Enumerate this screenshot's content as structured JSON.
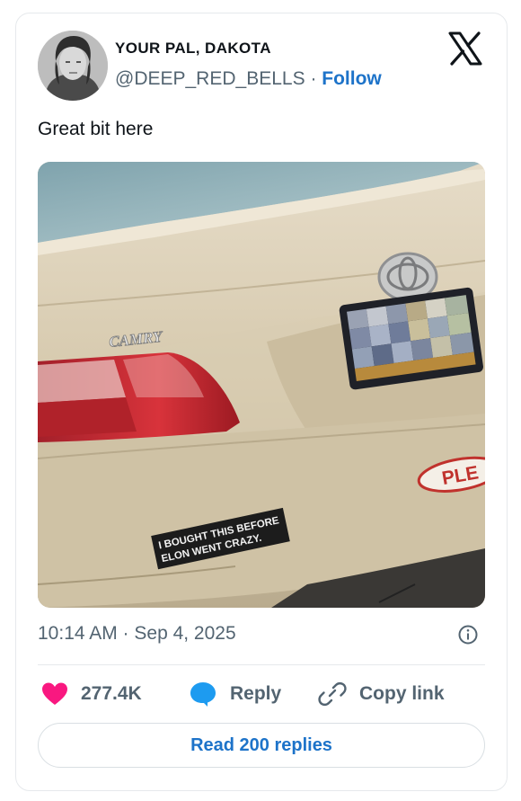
{
  "author": {
    "display_name": "YOUR PAL, DAKOTA",
    "handle": "@DEEP_RED_BELLS",
    "separator": "·",
    "follow_label": "Follow"
  },
  "brand_icon": "x-logo-icon",
  "tweet": {
    "text": "Great bit here",
    "timestamp": "10:14 AM · Sep 4, 2025"
  },
  "media": {
    "car_badge": "CAMRY",
    "sticker_line1": "I BOUGHT THIS BEFORE",
    "sticker_line2": "ELON WENT CRAZY.",
    "dealer_sticker": "PLE"
  },
  "actions": {
    "likes": "277.4K",
    "reply_label": "Reply",
    "copy_link_label": "Copy link",
    "read_replies_label": "Read 200 replies"
  },
  "colors": {
    "like_heart": "#f91880",
    "reply_bubble": "#1d9bf0",
    "link_blue": "#1d73c9"
  }
}
